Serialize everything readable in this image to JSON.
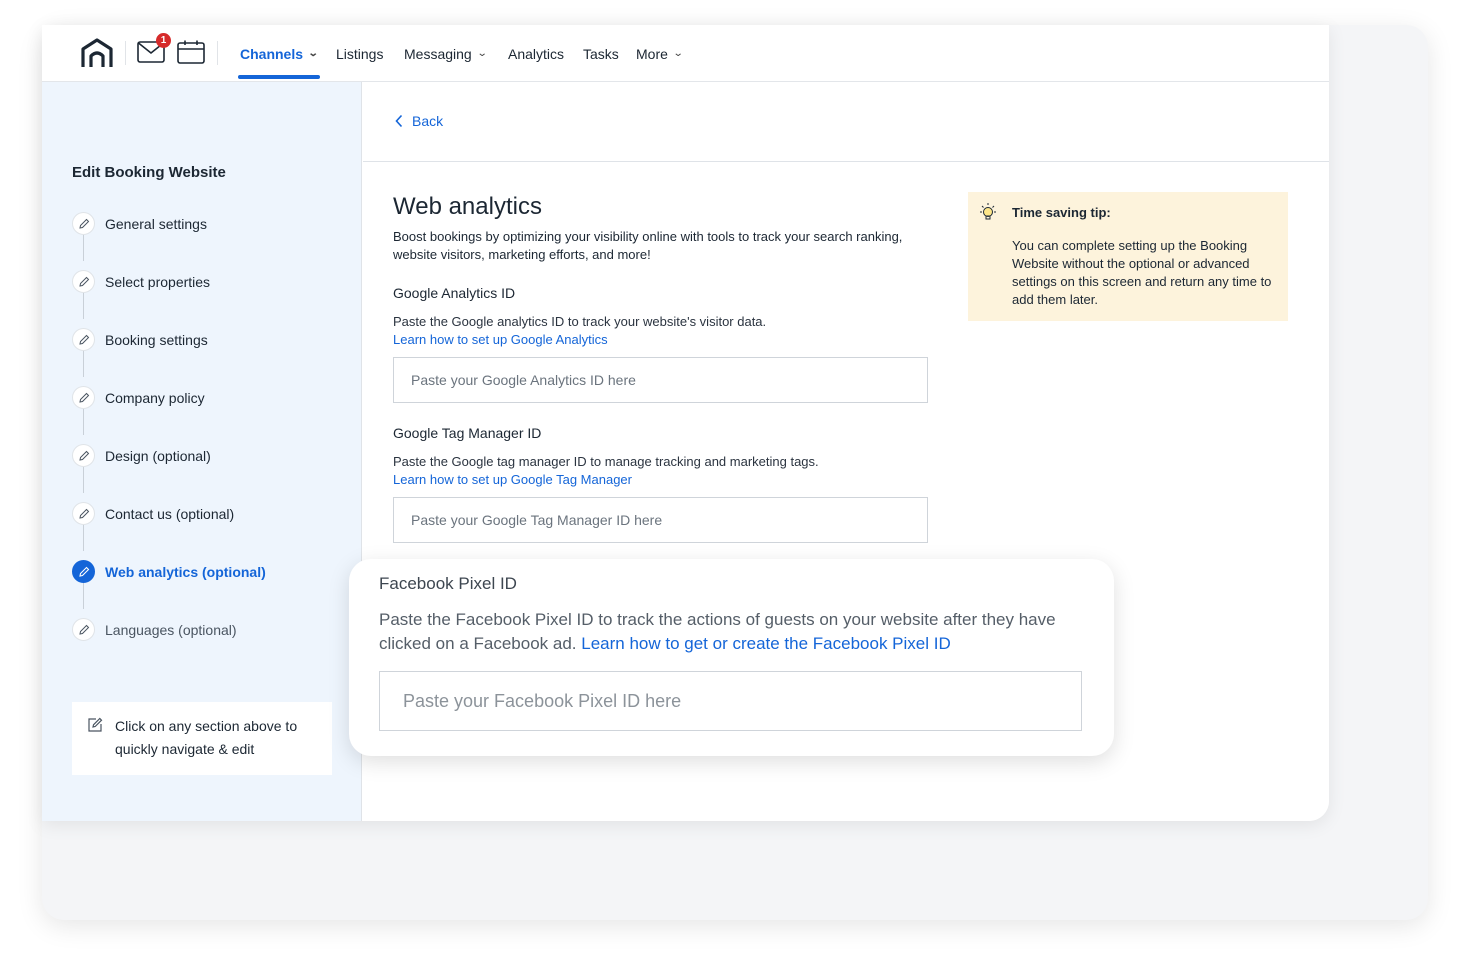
{
  "topbar": {
    "notification_count": "1",
    "nav": [
      {
        "label": "Channels",
        "has_dropdown": true,
        "active": true
      },
      {
        "label": "Listings",
        "has_dropdown": false,
        "active": false
      },
      {
        "label": "Messaging",
        "has_dropdown": true,
        "active": false
      },
      {
        "label": "Analytics",
        "has_dropdown": false,
        "active": false
      },
      {
        "label": "Tasks",
        "has_dropdown": false,
        "active": false
      },
      {
        "label": "More",
        "has_dropdown": true,
        "active": false
      }
    ],
    "accent_color": "#1465d8"
  },
  "sidebar": {
    "title": "Edit Booking Website",
    "steps": [
      {
        "label": "General settings",
        "state": "done"
      },
      {
        "label": "Select properties",
        "state": "done"
      },
      {
        "label": "Booking settings",
        "state": "done"
      },
      {
        "label": "Company policy",
        "state": "done"
      },
      {
        "label": "Design (optional)",
        "state": "done"
      },
      {
        "label": "Contact us (optional)",
        "state": "done"
      },
      {
        "label": "Web analytics (optional)",
        "state": "active"
      },
      {
        "label": "Languages (optional)",
        "state": "pending"
      }
    ],
    "hint": "Click on any section above to quickly navigate & edit"
  },
  "main": {
    "back_label": "Back",
    "title": "Web analytics",
    "intro": "Boost bookings by optimizing your visibility online with tools to track your search ranking, website visitors, marketing efforts, and more!",
    "google_analytics": {
      "label": "Google Analytics ID",
      "description": "Paste the Google analytics ID to track your website's visitor data.",
      "link": "Learn how to set up Google Analytics",
      "placeholder": "Paste your Google Analytics ID here",
      "value": ""
    },
    "tag_manager": {
      "label": "Google Tag Manager ID",
      "description": "Paste the Google tag manager ID to manage tracking and marketing tags.",
      "link": "Learn how to set up Google Tag Manager",
      "placeholder": "Paste your Google Tag Manager ID here",
      "value": ""
    },
    "tip": {
      "title": "Time saving tip:",
      "body": "You can complete setting up the Booking Website without the optional or advanced settings on this screen and return any time to add them later.",
      "background_color": "#fdf3dc"
    }
  },
  "facebook_card": {
    "label": "Facebook Pixel ID",
    "description": "Paste the Facebook Pixel ID to track the actions of guests on your website after they have clicked on a Facebook ad.",
    "link": "Learn how to get or create the Facebook Pixel ID",
    "placeholder": "Paste your Facebook Pixel ID here",
    "value": ""
  }
}
